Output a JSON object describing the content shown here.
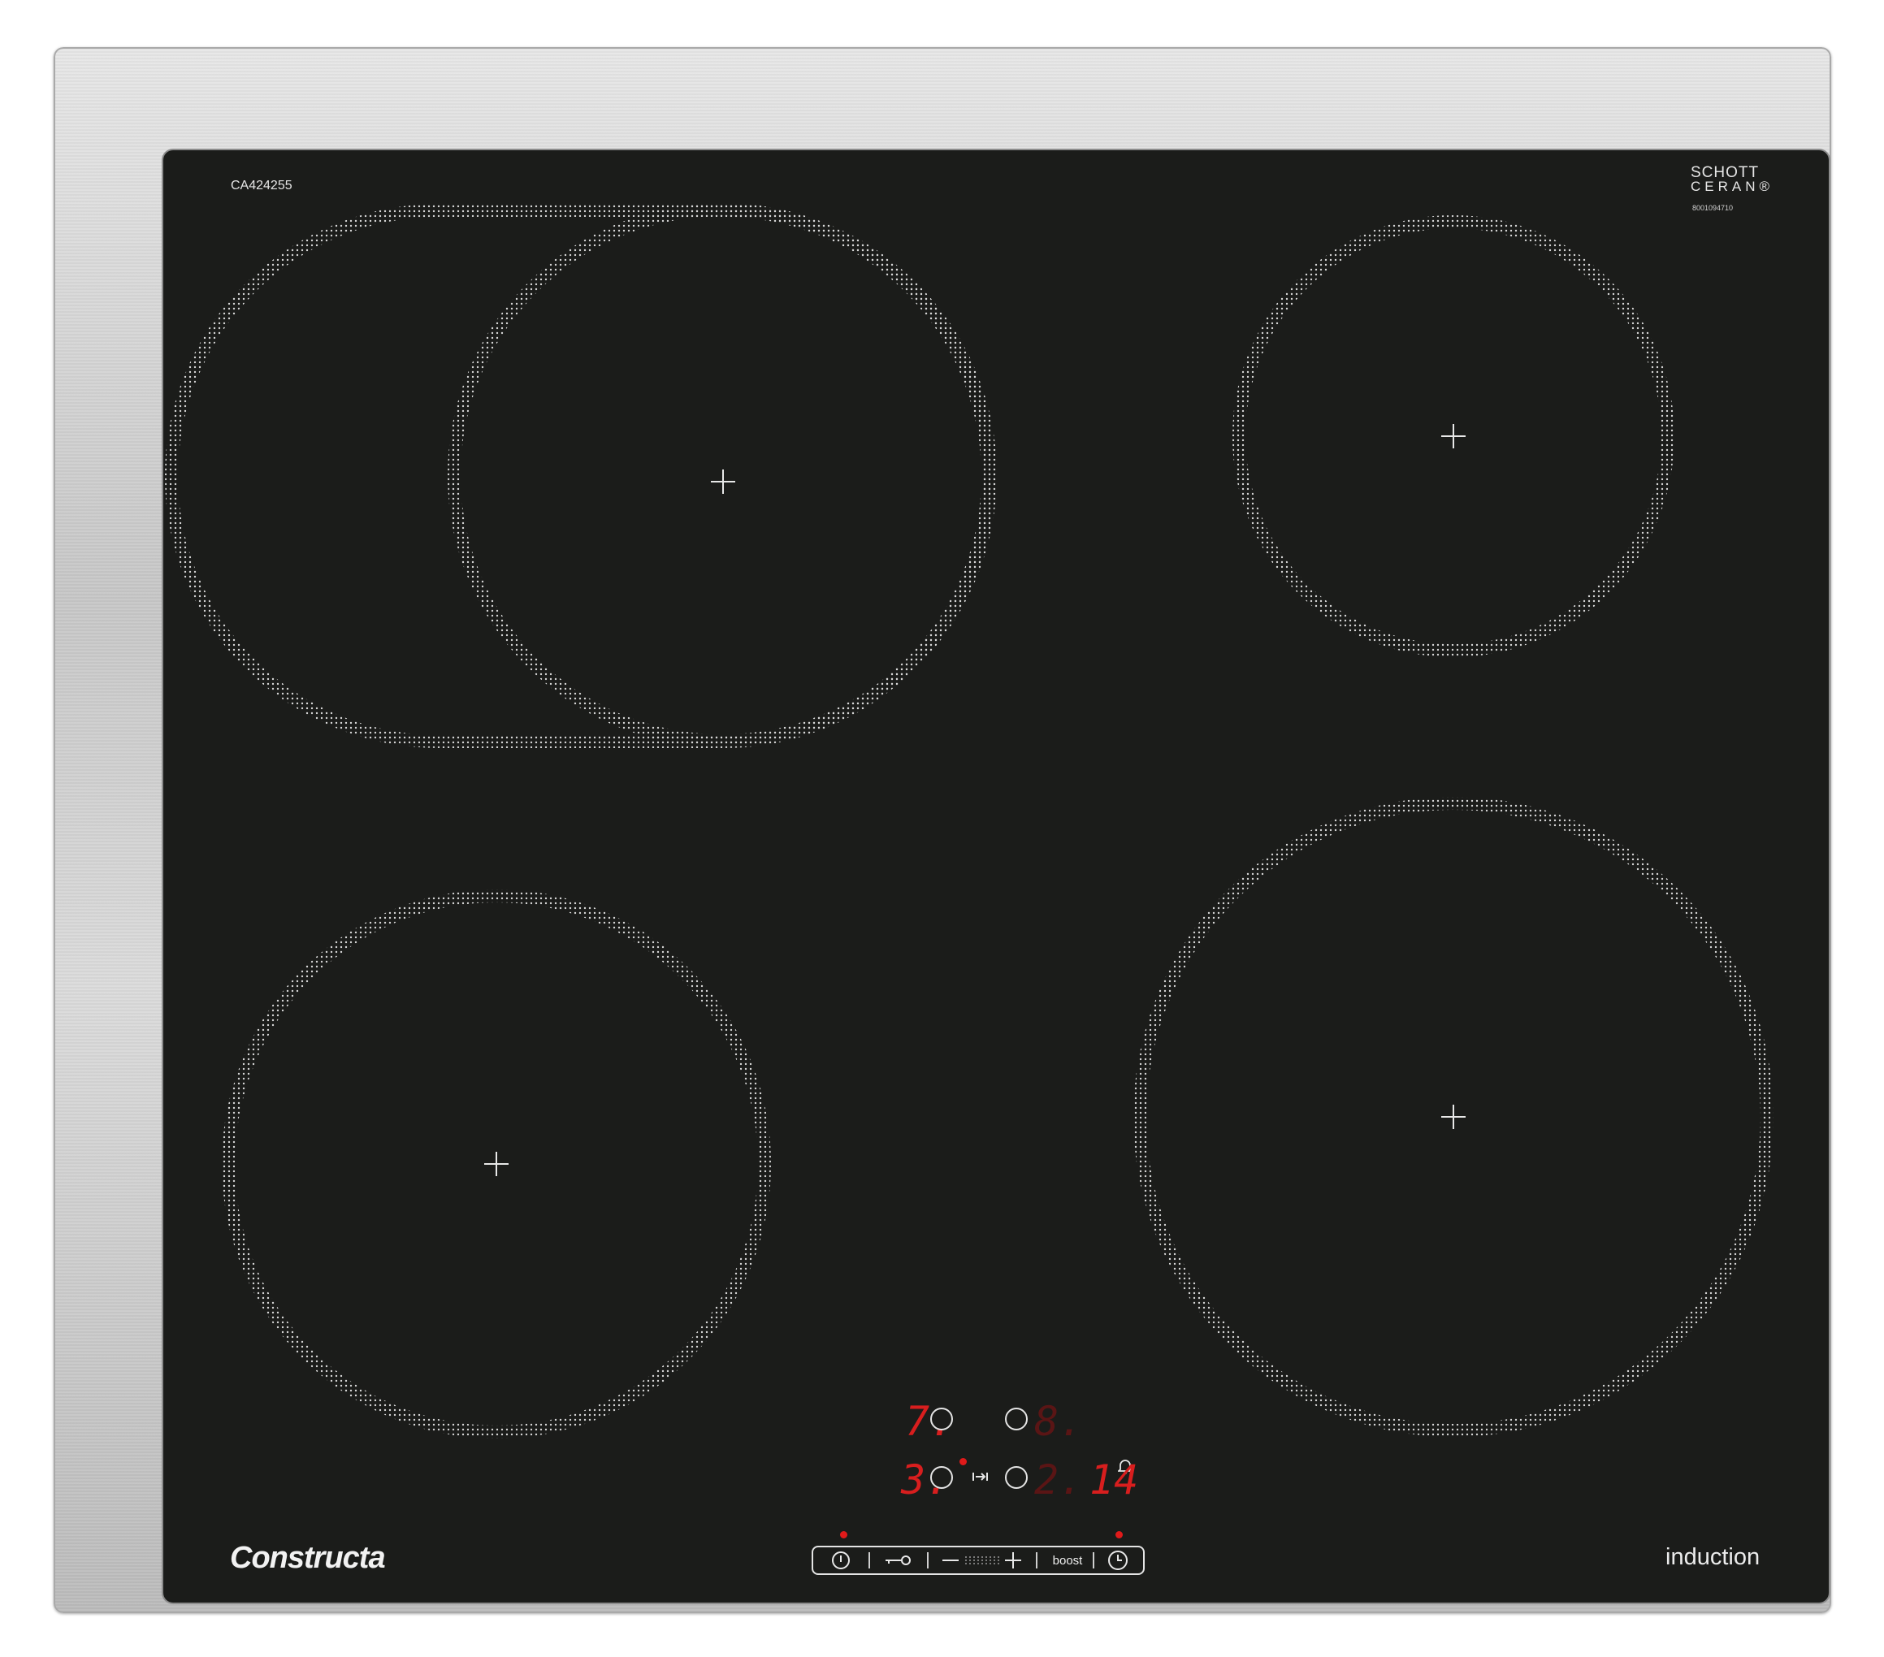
{
  "panel": {
    "model": "CA424255",
    "glass_brand_line1": "SCHOTT",
    "glass_brand_line2": "CERAN®",
    "serial": "8001094710",
    "brand_logo_text": "Constructa",
    "type_label": "induction"
  },
  "cooking_zones": [
    {
      "id": "front-left",
      "shape": "round"
    },
    {
      "id": "rear-left",
      "shape": "flex-oval"
    },
    {
      "id": "rear-right",
      "shape": "round"
    },
    {
      "id": "front-right",
      "shape": "round"
    }
  ],
  "display": {
    "rear_left_level": "7.",
    "rear_right_level": "8.",
    "front_left_level": "3.",
    "front_right_level": "2.",
    "timer_value": "14",
    "icons": [
      "zone-selector-icon",
      "bell-icon",
      "skip-arrow-icon"
    ]
  },
  "controls": {
    "power_icon": "power-icon",
    "lock_icon": "key-lock-icon",
    "minus_icon": "minus-icon",
    "plus_icon": "plus-icon",
    "boost_label": "boost",
    "timer_icon": "clock-icon"
  },
  "colors": {
    "glass": "#1b1c1a",
    "frame": "#cfcfcf",
    "display_red": "#d81e1e",
    "indicator_red": "#e01a1a"
  }
}
